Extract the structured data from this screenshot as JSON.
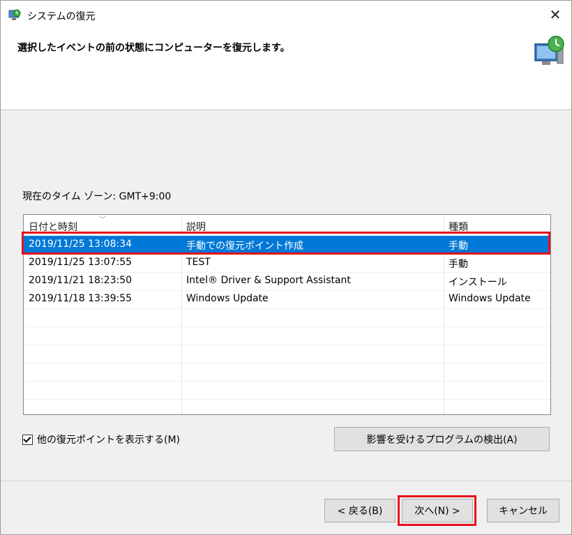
{
  "window": {
    "title": "システムの復元"
  },
  "header": {
    "text": "選択したイベントの前の状態にコンピューターを復元します。"
  },
  "timezone": {
    "label": "現在のタイム ゾーン: GMT+9:00"
  },
  "table": {
    "columns": [
      "日付と時刻",
      "説明",
      "種類"
    ],
    "rows": [
      {
        "date": "2019/11/25 13:08:34",
        "desc": "手動での復元ポイント作成",
        "type": "手動",
        "selected": true
      },
      {
        "date": "2019/11/25 13:07:55",
        "desc": "TEST",
        "type": "手動",
        "selected": false
      },
      {
        "date": "2019/11/21 18:23:50",
        "desc": "Intel® Driver & Support Assistant",
        "type": "インストール",
        "selected": false
      },
      {
        "date": "2019/11/18 13:39:55",
        "desc": "Windows Update",
        "type": "Windows Update",
        "selected": false
      }
    ]
  },
  "show_more": {
    "label": "他の復元ポイントを表示する(M)",
    "checked": true
  },
  "buttons": {
    "detect": "影響を受けるプログラムの検出(A)",
    "back": "< 戻る(B)",
    "next": "次へ(N) >",
    "cancel": "キャンセル"
  },
  "icons": {
    "app": "system-restore-icon",
    "header": "computer-restore-icon",
    "close": "close-icon"
  },
  "colors": {
    "selection": "#0078d7",
    "highlight": "#e8101a"
  }
}
